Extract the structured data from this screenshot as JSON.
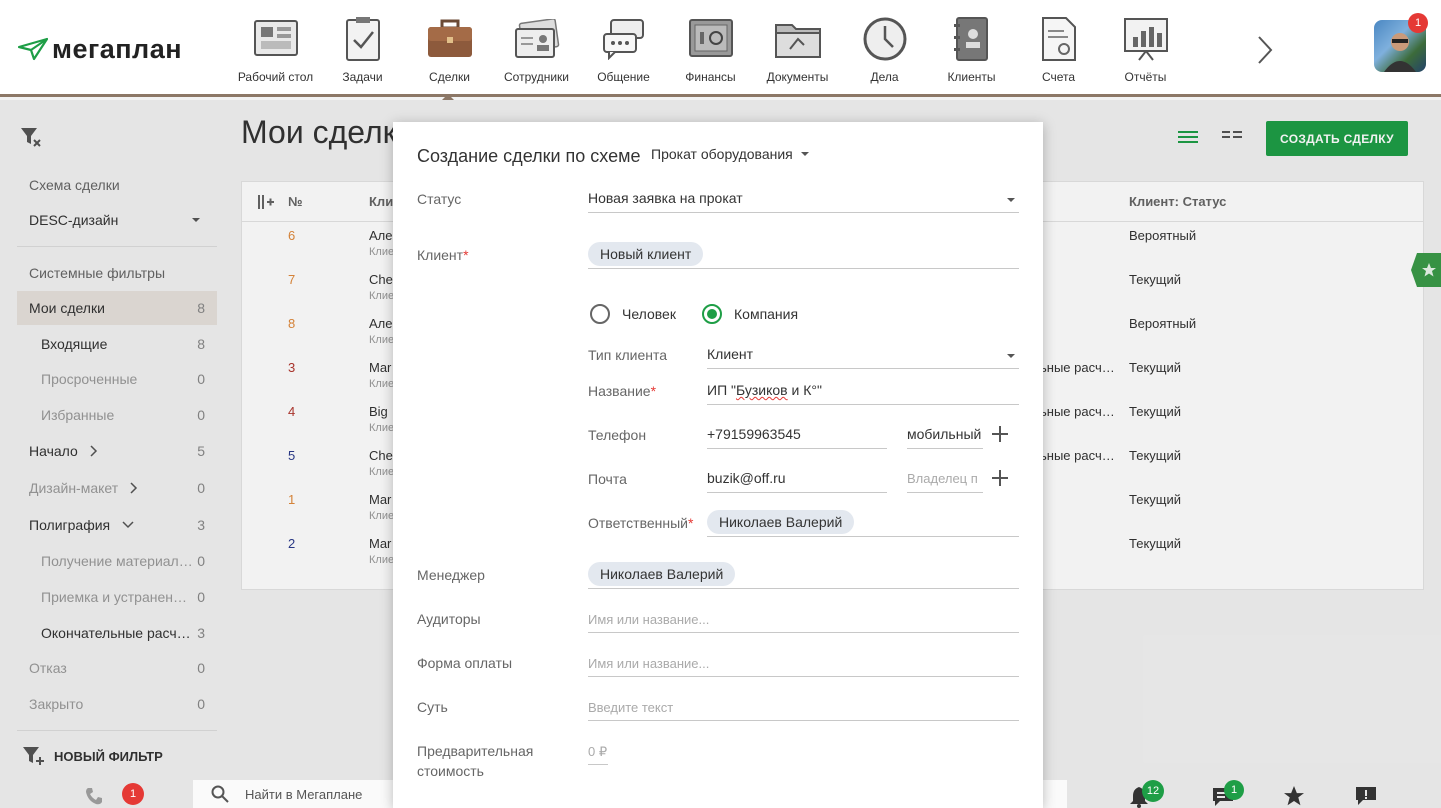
{
  "app": {
    "logo_text": "мегаплан"
  },
  "modules": [
    {
      "label": "Рабочий стол",
      "icon": "desktop-icon"
    },
    {
      "label": "Задачи",
      "icon": "tasks-icon"
    },
    {
      "label": "Сделки",
      "icon": "deals-briefcase-icon",
      "active": true
    },
    {
      "label": "Сотрудники",
      "icon": "employees-icon"
    },
    {
      "label": "Общение",
      "icon": "chat-icon"
    },
    {
      "label": "Финансы",
      "icon": "safe-icon"
    },
    {
      "label": "Документы",
      "icon": "folder-icon"
    },
    {
      "label": "Дела",
      "icon": "clock-icon"
    },
    {
      "label": "Клиенты",
      "icon": "contacts-book-icon"
    },
    {
      "label": "Счета",
      "icon": "invoice-icon"
    },
    {
      "label": "Отчёты",
      "icon": "reports-icon"
    }
  ],
  "user": {
    "notification_count": "1"
  },
  "sidebar": {
    "scheme_label": "Схема сделки",
    "scheme_value": "DESC-дизайн",
    "system_filters_label": "Системные фильтры",
    "items": [
      {
        "label": "Мои сделки",
        "count": "8"
      },
      {
        "label": "Входящие",
        "count": "8"
      },
      {
        "label": "Просроченные",
        "count": "0"
      },
      {
        "label": "Избранные",
        "count": "0"
      },
      {
        "label": "Начало",
        "count": "5"
      },
      {
        "label": "Дизайн-макет",
        "count": "0"
      },
      {
        "label": "Полиграфия",
        "count": "3"
      },
      {
        "label": "Получение материал…",
        "count": "0"
      },
      {
        "label": "Приемка и устранен…",
        "count": "0"
      },
      {
        "label": "Окончательные расч…",
        "count": "3"
      },
      {
        "label": "Отказ",
        "count": "0"
      },
      {
        "label": "Закрыто",
        "count": "0"
      }
    ],
    "new_filter_label": "НОВЫЙ ФИЛЬТР"
  },
  "main": {
    "page_title": "Мои сделк",
    "create_button": "СОЗДАТЬ СДЕЛКУ",
    "columns": {
      "num": "№",
      "client": "Кли",
      "client_status": "Клиент: Статус"
    },
    "rows": [
      {
        "num": "6",
        "num_color": "#e08a3c",
        "name": "Але",
        "sub": "Клие",
        "phase": "",
        "status": "Вероятный"
      },
      {
        "num": "7",
        "num_color": "#e08a3c",
        "name": "Che",
        "sub": "Клие",
        "phase": "",
        "status": "Текущий"
      },
      {
        "num": "8",
        "num_color": "#e08a3c",
        "name": "Але",
        "sub": "Клие",
        "phase": "",
        "status": "Вероятный"
      },
      {
        "num": "3",
        "num_color": "#b2362e",
        "name": "Mar",
        "sub": "Клие",
        "phase": "ьные расч…",
        "status": "Текущий"
      },
      {
        "num": "4",
        "num_color": "#b2362e",
        "name": "Big",
        "sub": "Клие",
        "phase": "ьные расч…",
        "status": "Текущий"
      },
      {
        "num": "5",
        "num_color": "#2b3a8c",
        "name": "Che",
        "sub": "Клие",
        "phase": "ьные расч…",
        "status": "Текущий"
      },
      {
        "num": "1",
        "num_color": "#e08a3c",
        "name": "Mar",
        "sub": "Клие",
        "phase": "",
        "status": "Текущий"
      },
      {
        "num": "2",
        "num_color": "#2b3a8c",
        "name": "Mar",
        "sub": "Клие",
        "phase": "",
        "status": "Текущий"
      }
    ]
  },
  "modal": {
    "title": "Создание сделки по схеме",
    "scheme": "Прокат оборудования",
    "status_label": "Статус",
    "status_value": "Новая заявка на прокат",
    "client_label": "Клиент",
    "client_chip": "Новый клиент",
    "radio_person": "Человек",
    "radio_company": "Компания",
    "client_type_label": "Тип клиента",
    "client_type_value": "Клиент",
    "name_label": "Название",
    "name_value_pre": "ИП \"",
    "name_value_word": "Бузиков",
    "name_value_post": " и К°\"",
    "phone_label": "Телефон",
    "phone_value": "+79159963545",
    "phone_type": "мобильный",
    "email_label": "Почта",
    "email_value": "buzik@off.ru",
    "email_owner_placeholder": "Владелец п",
    "responsible_label": "Ответственный",
    "responsible_chip": "Николаев Валерий",
    "manager_label": "Менеджер",
    "manager_chip": "Николаев Валерий",
    "auditors_label": "Аудиторы",
    "auditors_placeholder": "Имя или название...",
    "payment_label": "Форма оплаты",
    "payment_placeholder": "Имя или название...",
    "essence_label": "Суть",
    "essence_placeholder": "Введите текст",
    "price_label_line1": "Предварительная",
    "price_label_line2": "стоимость",
    "price_value": "0 ₽"
  },
  "bottombar": {
    "search_placeholder": "Найти в Мегаплане",
    "calls_badge": "1",
    "notifications_badge": "12",
    "messages_badge": "1"
  },
  "colors": {
    "accent_green": "#1e9e46",
    "brand_brown": "#8c7766",
    "badge_red": "#e53935"
  }
}
